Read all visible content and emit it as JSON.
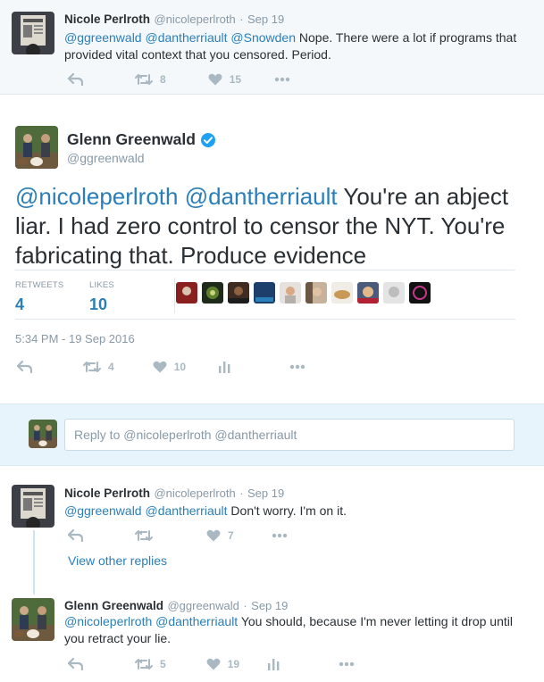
{
  "top_tweet": {
    "name": "Nicole Perlroth",
    "handle": "@nicoleperlroth",
    "time": "Sep 19",
    "mentions": "@ggreenwald @dantherriault @Snowden",
    "text_line1": "Nope. There were a lot if programs that",
    "text_line2": "provided vital context that you censored. Period.",
    "retweets": "8",
    "likes": "15"
  },
  "main_tweet": {
    "name": "Glenn Greenwald",
    "handle": "@ggreenwald",
    "mentions": "@nicoleperlroth @dantherriault",
    "text_line1_tail": " You're an abject",
    "text_line2": "liar. I had zero control to censor the NYT. You're",
    "text_line3": "fabricating that. Produce evidence",
    "retweets_label": "RETWEETS",
    "retweets": "4",
    "likes_label": "LIKES",
    "likes": "10",
    "timestamp": "5:34 PM - 19 Sep 2016",
    "action_retweets": "4",
    "action_likes": "10"
  },
  "reply_box": {
    "placeholder": "Reply to @nicoleperlroth @dantherriault"
  },
  "reply1": {
    "name": "Nicole Perlroth",
    "handle": "@nicoleperlroth",
    "time": "Sep 19",
    "mentions": "@ggreenwald @dantherriault",
    "text": "Don't worry. I'm on it.",
    "likes": "7"
  },
  "view_other_replies": "View other replies",
  "reply2": {
    "name": "Glenn Greenwald",
    "handle": "@ggreenwald",
    "time": "Sep 19",
    "mentions": "@nicoleperlroth @dantherriault",
    "text_line1": "You should, because I'm never letting it drop until",
    "text_line2": "you retract your lie.",
    "retweets": "5",
    "likes": "19"
  },
  "colors": {
    "link": "#2a7fba",
    "verified": "#1da1f2",
    "icon_gray": "#aab8c2"
  }
}
